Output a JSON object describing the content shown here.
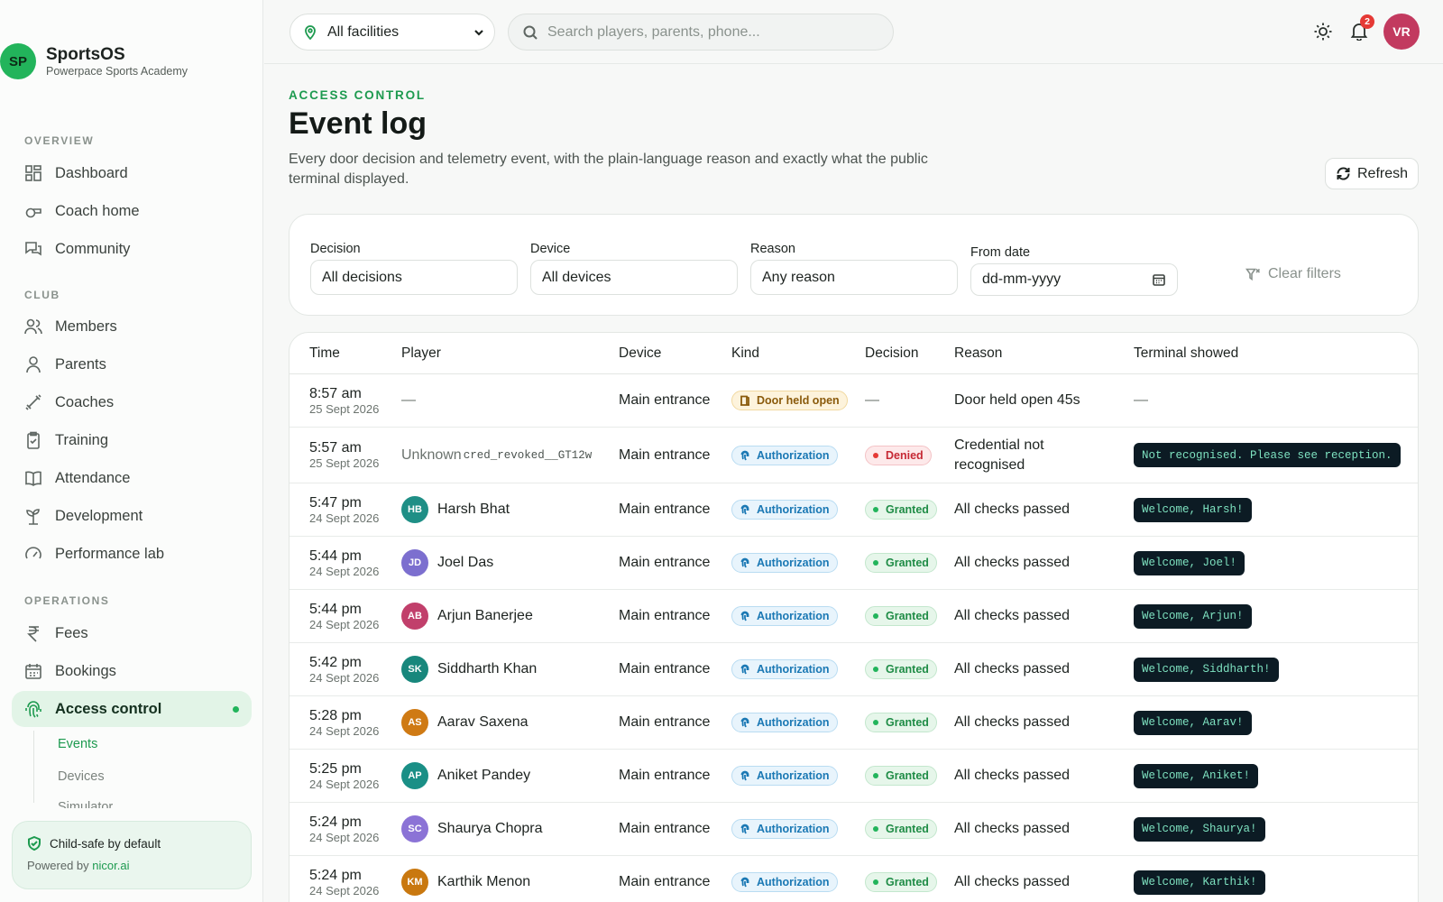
{
  "brand": {
    "initials": "SP",
    "name": "SportsOS",
    "subtitle": "Powerpace Sports Academy"
  },
  "sidebar": {
    "sections": [
      {
        "label": "OVERVIEW",
        "items": [
          "Dashboard",
          "Coach home",
          "Community"
        ]
      },
      {
        "label": "CLUB",
        "items": [
          "Members",
          "Parents",
          "Coaches",
          "Training",
          "Attendance",
          "Development",
          "Performance lab"
        ]
      },
      {
        "label": "OPERATIONS",
        "items": [
          "Fees",
          "Bookings",
          "Access control"
        ]
      }
    ],
    "subnav": [
      "Events",
      "Devices",
      "Simulator"
    ],
    "safe_title": "Child-safe by default",
    "powered_prefix": "Powered by",
    "powered_link": "nicor.ai"
  },
  "topbar": {
    "facility": "All facilities",
    "search_placeholder": "Search players, parents, phone...",
    "notifications": "2",
    "user_initials": "VR"
  },
  "page": {
    "eyebrow": "ACCESS CONTROL",
    "title": "Event log",
    "description": "Every door decision and telemetry event, with the plain-language reason and exactly what the public terminal displayed.",
    "refresh_label": "Refresh"
  },
  "filters": {
    "decision_label": "Decision",
    "decision_value": "All decisions",
    "device_label": "Device",
    "device_value": "All devices",
    "reason_label": "Reason",
    "reason_value": "Any reason",
    "date_label": "From date",
    "date_value": "dd-mm-yyyy",
    "clear_label": "Clear filters"
  },
  "table": {
    "headers": [
      "Time",
      "Player",
      "Device",
      "Kind",
      "Decision",
      "Reason",
      "Terminal showed"
    ],
    "rows": [
      {
        "time": "8:57 am",
        "date": "25 Sept 2026",
        "initials": "",
        "player": "—",
        "device": "Main entrance",
        "kind": "Door held open",
        "decision": "—",
        "reason": "Door held open 45s",
        "terminal": "—"
      },
      {
        "time": "5:57 am",
        "date": "25 Sept 2026",
        "initials": "",
        "player": "Unknown",
        "credential": "cred_revoked__GT12w",
        "device": "Main entrance",
        "kind": "Authorization",
        "decision": "Denied",
        "reason": "Credential not recognised",
        "terminal": "Not recognised. Please see reception."
      },
      {
        "time": "5:47 pm",
        "date": "24 Sept 2026",
        "initials": "HB",
        "player": "Harsh Bhat",
        "device": "Main entrance",
        "kind": "Authorization",
        "decision": "Granted",
        "reason": "All checks passed",
        "terminal": "Welcome, Harsh!"
      },
      {
        "time": "5:44 pm",
        "date": "24 Sept 2026",
        "initials": "JD",
        "player": "Joel Das",
        "device": "Main entrance",
        "kind": "Authorization",
        "decision": "Granted",
        "reason": "All checks passed",
        "terminal": "Welcome, Joel!"
      },
      {
        "time": "5:44 pm",
        "date": "24 Sept 2026",
        "initials": "AB",
        "player": "Arjun Banerjee",
        "device": "Main entrance",
        "kind": "Authorization",
        "decision": "Granted",
        "reason": "All checks passed",
        "terminal": "Welcome, Arjun!"
      },
      {
        "time": "5:42 pm",
        "date": "24 Sept 2026",
        "initials": "SK",
        "player": "Siddharth Khan",
        "device": "Main entrance",
        "kind": "Authorization",
        "decision": "Granted",
        "reason": "All checks passed",
        "terminal": "Welcome, Siddharth!"
      },
      {
        "time": "5:28 pm",
        "date": "24 Sept 2026",
        "initials": "AS",
        "player": "Aarav Saxena",
        "device": "Main entrance",
        "kind": "Authorization",
        "decision": "Granted",
        "reason": "All checks passed",
        "terminal": "Welcome, Aarav!"
      },
      {
        "time": "5:25 pm",
        "date": "24 Sept 2026",
        "initials": "AP",
        "player": "Aniket Pandey",
        "device": "Main entrance",
        "kind": "Authorization",
        "decision": "Granted",
        "reason": "All checks passed",
        "terminal": "Welcome, Aniket!"
      },
      {
        "time": "5:24 pm",
        "date": "24 Sept 2026",
        "initials": "SC",
        "player": "Shaurya Chopra",
        "device": "Main entrance",
        "kind": "Authorization",
        "decision": "Granted",
        "reason": "All checks passed",
        "terminal": "Welcome, Shaurya!"
      },
      {
        "time": "5:24 pm",
        "date": "24 Sept 2026",
        "initials": "KM",
        "player": "Karthik Menon",
        "device": "Main entrance",
        "kind": "Authorization",
        "decision": "Granted",
        "reason": "All checks passed",
        "terminal": "Welcome, Karthik!"
      }
    ]
  },
  "colors": {
    "accent": "#22b45b",
    "avatars": [
      "#1f8f86",
      "#7c6fcf",
      "#c13f6b",
      "#18877c",
      "#cf7a14",
      "#1a8f86",
      "#8b73d6",
      "#c9780f"
    ]
  }
}
